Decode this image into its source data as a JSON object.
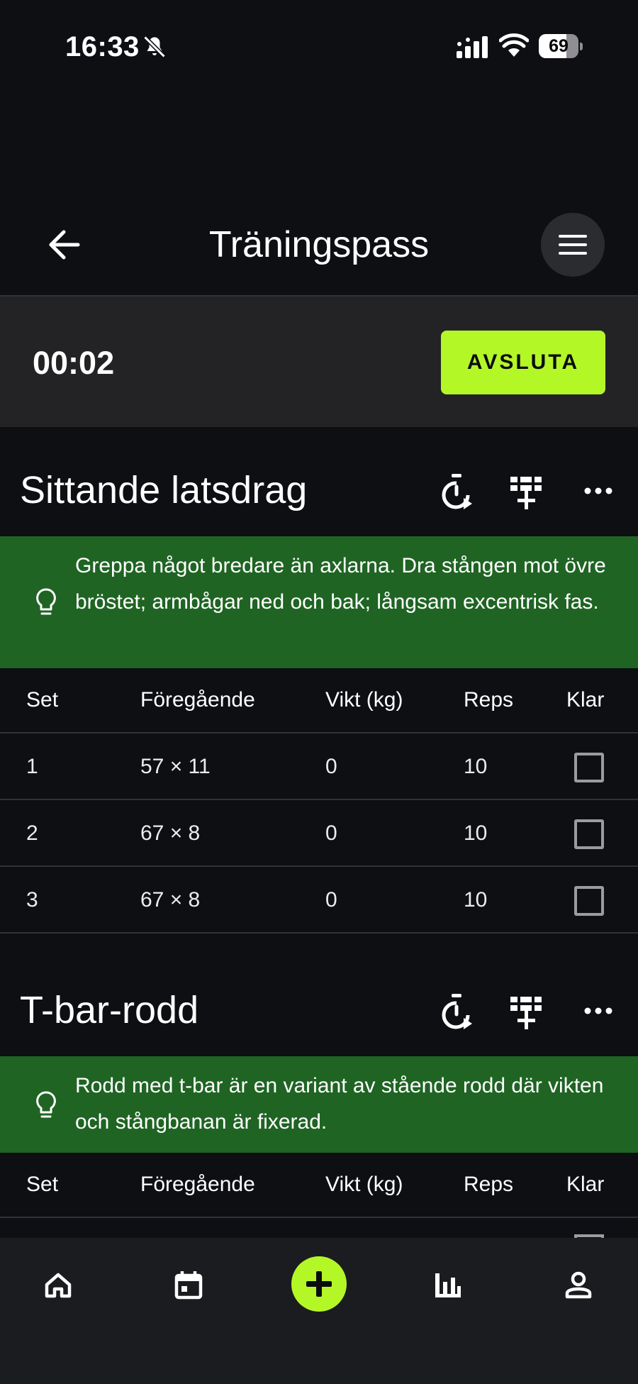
{
  "status_bar": {
    "time": "16:33",
    "battery_level": "69",
    "battery_fraction": 0.69
  },
  "header": {
    "title": "Träningspass"
  },
  "workout": {
    "timer": "00:02",
    "finish_label": "AVSLUTA"
  },
  "table_headers": {
    "set": "Set",
    "previous": "Föregående",
    "weight": "Vikt (kg)",
    "reps": "Reps",
    "done": "Klar"
  },
  "exercises": [
    {
      "name": "Sittande latsdrag",
      "tip": "Greppa något bredare än axlarna. Dra stången mot övre bröstet; armbågar ned och bak; långsam excentrisk fas.",
      "sets": [
        {
          "set": "1",
          "previous": "57 × 11",
          "weight": "0",
          "reps": "10",
          "done": false
        },
        {
          "set": "2",
          "previous": "67 × 8",
          "weight": "0",
          "reps": "10",
          "done": false
        },
        {
          "set": "3",
          "previous": "67 × 8",
          "weight": "0",
          "reps": "10",
          "done": false
        }
      ]
    },
    {
      "name": "T-bar-rodd",
      "tip": "Rodd med t-bar är en variant av stående rodd där vikten och stångbanan är fixerad.",
      "sets": []
    }
  ],
  "colors": {
    "accent": "#b4f727",
    "tip_background": "#1f6423",
    "background": "#0d0f13",
    "timer_bar": "#232325",
    "nav_background": "#1b1c20"
  },
  "icons": {
    "header": [
      "back-arrow-icon",
      "hamburger-menu-icon"
    ],
    "exercise_actions": [
      "rest-timer-icon",
      "add-set-icon",
      "more-options-icon"
    ],
    "tip": "lightbulb-icon",
    "nav": [
      "home-icon",
      "calendar-icon",
      "add-icon",
      "stats-icon",
      "profile-icon"
    ]
  }
}
